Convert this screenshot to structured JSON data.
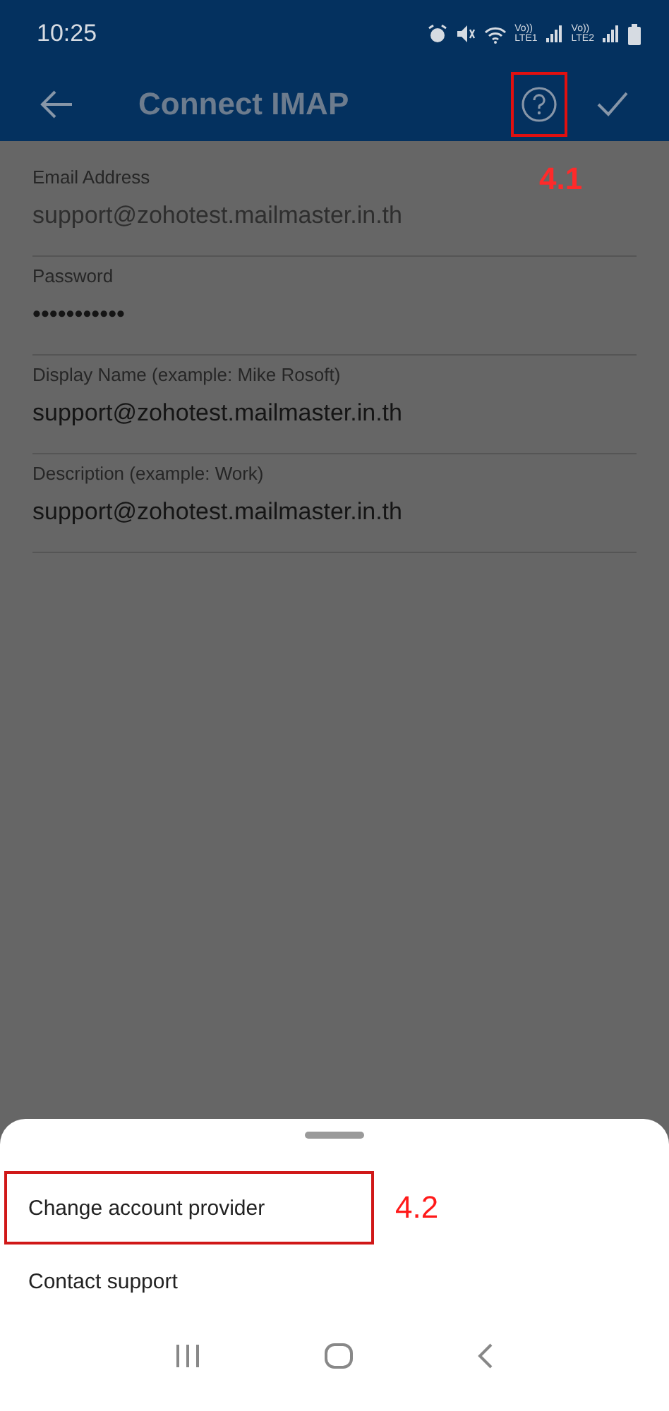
{
  "status_bar": {
    "time": "10:25",
    "sims": [
      {
        "top": "Vo))",
        "bottom": "LTE1"
      },
      {
        "top": "Vo))",
        "bottom": "LTE2"
      }
    ]
  },
  "app_bar": {
    "title": "Connect IMAP",
    "help_highlighted": true
  },
  "fields": [
    {
      "label": "Email Address",
      "value": "support@zohotest.mailmaster.in.th",
      "disabled": true
    },
    {
      "label": "Password",
      "value": "•••••••••••",
      "disabled": false
    },
    {
      "label": "Display Name (example: Mike Rosoft)",
      "value": "support@zohotest.mailmaster.in.th",
      "disabled": false
    },
    {
      "label": "Description (example: Work)",
      "value": "support@zohotest.mailmaster.in.th",
      "disabled": false
    }
  ],
  "annotations": [
    "4.1",
    "4.2"
  ],
  "sheet": {
    "items": [
      {
        "label": "Change account provider",
        "highlighted": true
      },
      {
        "label": "Contact support",
        "highlighted": false
      }
    ]
  }
}
